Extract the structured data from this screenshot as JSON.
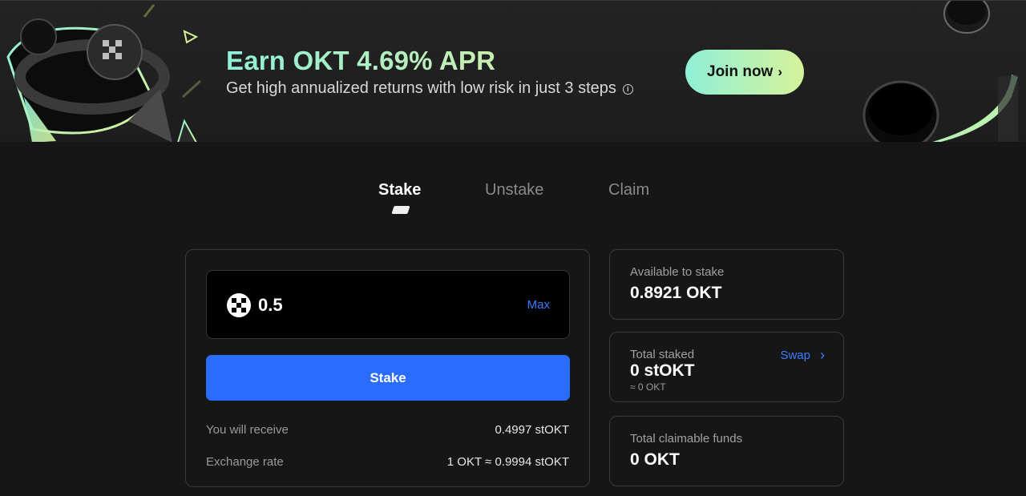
{
  "banner": {
    "title": "Earn OKT 4.69% APR",
    "subtitle": "Get high annualized returns with low risk in just 3 steps",
    "info_icon": "info-icon",
    "join_label": "Join now",
    "join_chevron": "›"
  },
  "tabs": [
    {
      "label": "Stake",
      "active": true
    },
    {
      "label": "Unstake",
      "active": false
    },
    {
      "label": "Claim",
      "active": false
    }
  ],
  "stake_form": {
    "amount": "0.5",
    "token_icon": "okt-logo-icon",
    "max_label": "Max",
    "button_label": "Stake",
    "receive_label": "You will receive",
    "receive_value": "0.4997 stOKT",
    "rate_label": "Exchange rate",
    "rate_value": "1 OKT ≈ 0.9994 stOKT"
  },
  "cards": {
    "available": {
      "label": "Available to stake",
      "value": "0.8921 OKT"
    },
    "staked": {
      "label": "Total staked",
      "value": "0 stOKT",
      "sub": "≈ 0 OKT",
      "swap_label": "Swap",
      "swap_chevron": "›"
    },
    "claimable": {
      "label": "Total claimable funds",
      "value": "0 OKT"
    }
  },
  "colors": {
    "accent_blue": "#2a6cff",
    "link_blue": "#3d7bff",
    "mint": "#8ff0d8",
    "lime": "#d6f29a",
    "background": "#161616"
  }
}
